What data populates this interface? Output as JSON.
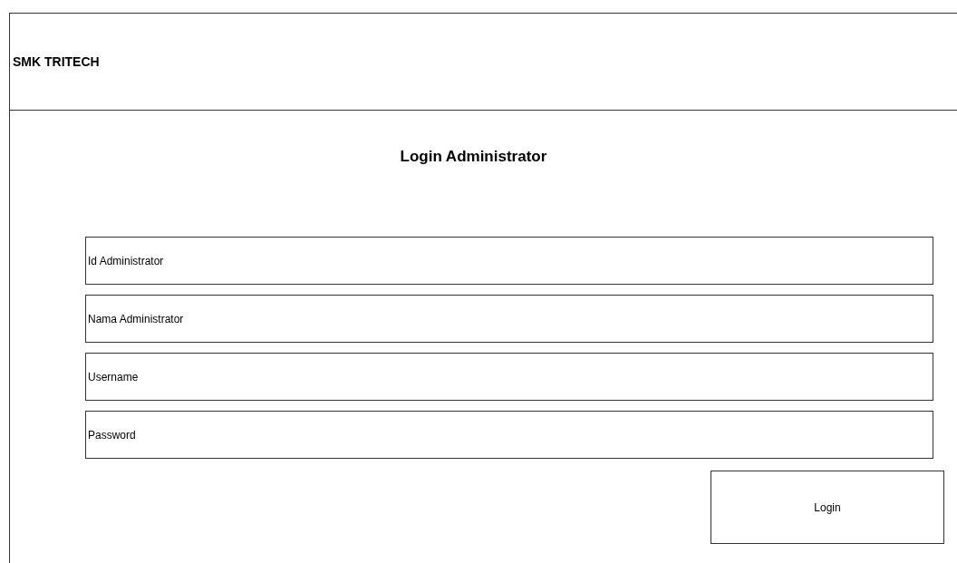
{
  "header": {
    "title": "SMK TRITECH"
  },
  "form": {
    "title": "Login Administrator",
    "fields": [
      {
        "placeholder": "Id Administrator"
      },
      {
        "placeholder": "Nama Administrator"
      },
      {
        "placeholder": "Username"
      },
      {
        "placeholder": "Password"
      }
    ],
    "button": "Login"
  }
}
